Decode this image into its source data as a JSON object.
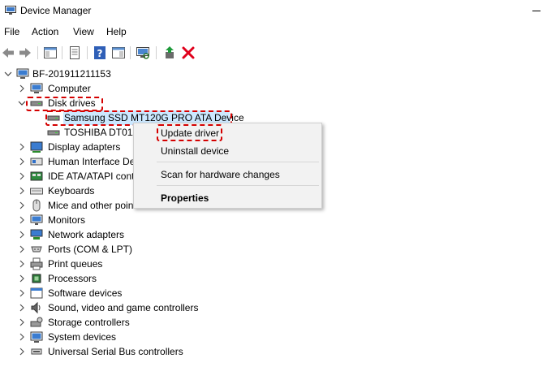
{
  "window": {
    "title": "Device Manager"
  },
  "menu": [
    "File",
    "Action",
    "View",
    "Help"
  ],
  "toolbar": [
    "back-arrow-icon",
    "forward-arrow-icon",
    "show-hide-console-tree-icon",
    "properties-icon",
    "help-icon",
    "action-pane-icon",
    "scan-hardware-icon",
    "update-driver-icon",
    "uninstall-icon"
  ],
  "tree": {
    "root": "BF-201911211153",
    "computer": "Computer",
    "disk_drives": "Disk drives",
    "disk_children": [
      "Samsung SSD MT120G PRO ATA Device",
      "TOSHIBA DT01AC"
    ],
    "categories": [
      "Display adapters",
      "Human Interface De",
      "IDE ATA/ATAPI contr",
      "Keyboards",
      "Mice and other poin",
      "Monitors",
      "Network adapters",
      "Ports (COM & LPT)",
      "Print queues",
      "Processors",
      "Software devices",
      "Sound, video and game controllers",
      "Storage controllers",
      "System devices",
      "Universal Serial Bus controllers"
    ]
  },
  "context_menu": {
    "update_driver": "Update driver",
    "uninstall_device": "Uninstall device",
    "scan": "Scan for hardware changes",
    "properties": "Properties"
  },
  "colors": {
    "highlight_dash": "#d40000",
    "selection": "#cce8ff",
    "delete_icon": "#e0001b"
  }
}
